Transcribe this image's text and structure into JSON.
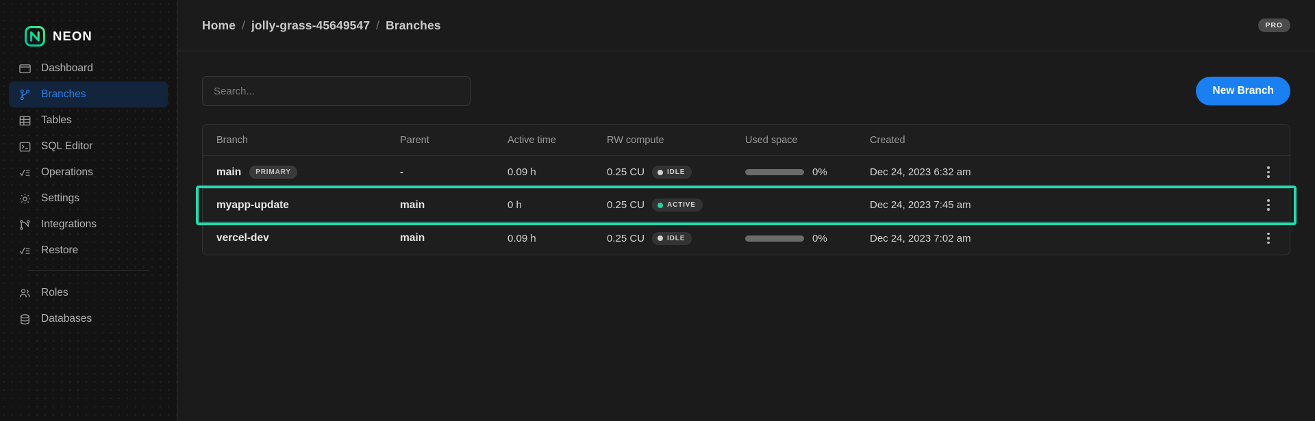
{
  "brand": {
    "name": "NEON",
    "logo_icon": "neon-logo-icon",
    "accent": "#00e599"
  },
  "sidebar": {
    "items": [
      {
        "label": "Dashboard",
        "icon": "dashboard-icon",
        "active": false
      },
      {
        "label": "Branches",
        "icon": "branches-icon",
        "active": true
      },
      {
        "label": "Tables",
        "icon": "tables-icon",
        "active": false
      },
      {
        "label": "SQL Editor",
        "icon": "sql-editor-icon",
        "active": false
      },
      {
        "label": "Operations",
        "icon": "operations-icon",
        "active": false
      },
      {
        "label": "Settings",
        "icon": "gear-icon",
        "active": false
      },
      {
        "label": "Integrations",
        "icon": "integrations-icon",
        "active": false
      },
      {
        "label": "Restore",
        "icon": "restore-icon",
        "active": false
      }
    ],
    "items_secondary": [
      {
        "label": "Roles",
        "icon": "users-icon"
      },
      {
        "label": "Databases",
        "icon": "database-icon"
      }
    ]
  },
  "header": {
    "breadcrumb": {
      "home": "Home",
      "project": "jolly-grass-45649547",
      "page": "Branches",
      "separator": "/"
    },
    "plan_badge": "PRO"
  },
  "toolbar": {
    "search_placeholder": "Search...",
    "search_value": "",
    "new_branch_label": "New Branch",
    "new_branch_color": "#1a7ff0"
  },
  "table": {
    "columns": [
      "Branch",
      "Parent",
      "Active time",
      "RW compute",
      "Used space",
      "Created"
    ],
    "highlight_color": "#23dbb0",
    "rows": [
      {
        "branch": "main",
        "tag": "PRIMARY",
        "parent": "-",
        "active_time": "0.09 h",
        "rw_compute": "0.25 CU",
        "state": "IDLE",
        "state_kind": "idle",
        "used_space_pct": "0%",
        "has_space_bar": true,
        "created": "Dec 24, 2023 6:32 am",
        "highlighted": false
      },
      {
        "branch": "myapp-update",
        "tag": "",
        "parent": "main",
        "active_time": "0 h",
        "rw_compute": "0.25 CU",
        "state": "ACTIVE",
        "state_kind": "active",
        "used_space_pct": "",
        "has_space_bar": false,
        "created": "Dec 24, 2023 7:45 am",
        "highlighted": true
      },
      {
        "branch": "vercel-dev",
        "tag": "",
        "parent": "main",
        "active_time": "0.09 h",
        "rw_compute": "0.25 CU",
        "state": "IDLE",
        "state_kind": "idle",
        "used_space_pct": "0%",
        "has_space_bar": true,
        "created": "Dec 24, 2023 7:02 am",
        "highlighted": false
      }
    ],
    "row_menu_icon": "kebab-menu-icon"
  }
}
